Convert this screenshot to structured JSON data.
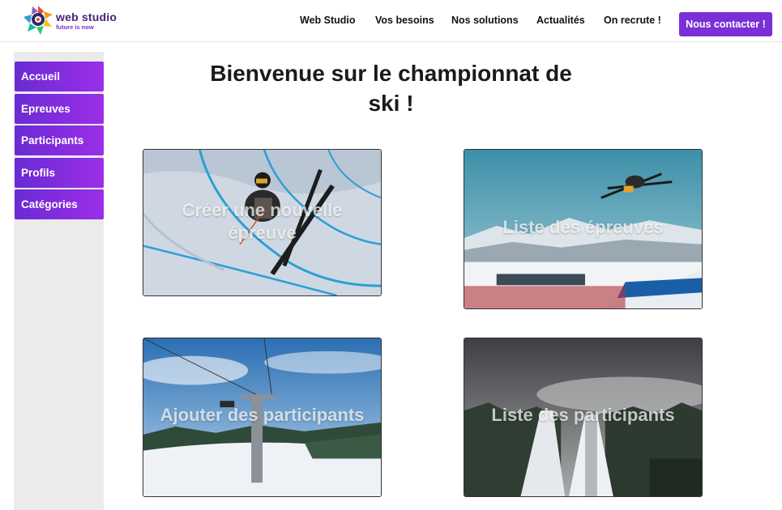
{
  "brand": {
    "name": "web studio",
    "tagline": "future is now",
    "colors": {
      "purple": "#7b2fd8",
      "dark_purple": "#4a1e7a"
    }
  },
  "nav": {
    "items": [
      {
        "label": "Web Studio"
      },
      {
        "label": "Vos besoins"
      },
      {
        "label": "Nos solutions"
      },
      {
        "label": "Actualités"
      },
      {
        "label": "On recrute !"
      }
    ],
    "cta_label": "Nous contacter !"
  },
  "sidebar": {
    "items": [
      {
        "label": "Accueil"
      },
      {
        "label": "Epreuves"
      },
      {
        "label": "Participants"
      },
      {
        "label": "Profils"
      },
      {
        "label": "Catégories"
      }
    ]
  },
  "main": {
    "title_line1": "Bienvenue sur le championnat de",
    "title_line2": "ski !",
    "cards": [
      {
        "label_line1": "Créer une nouvelle",
        "label_line2": "épreuve",
        "image": "halfpipe-skier"
      },
      {
        "label_line1": "Liste des épreuves",
        "image": "ski-jump-aerial"
      },
      {
        "label_line1": "Ajouter des participants",
        "image": "chairlift-slope"
      },
      {
        "label_line1": "Liste des participants",
        "image": "ski-jump-ramp-forest"
      }
    ]
  }
}
